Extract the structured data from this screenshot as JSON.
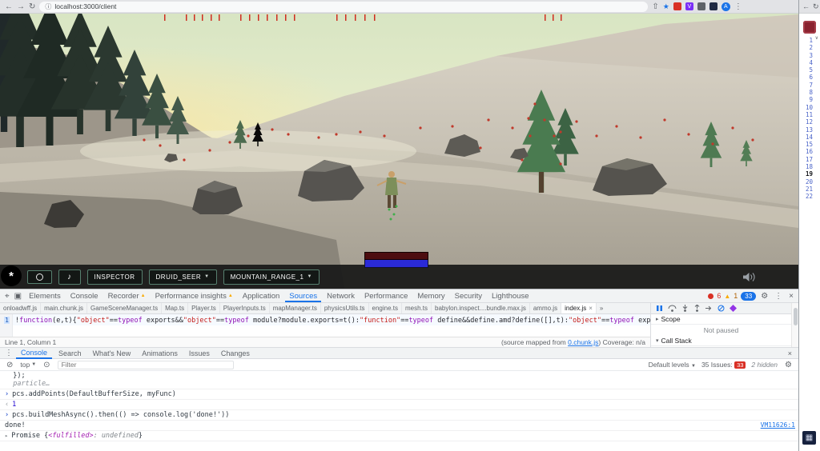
{
  "browser": {
    "url": "localhost:3000/client",
    "avatar": "A"
  },
  "game": {
    "hud": {
      "music_icon": "♪",
      "inspector_label": "INSPECTOR",
      "character_select": "DRUID_SEER",
      "map_select": "MOUNTAIN_RANGE_1"
    }
  },
  "devtools": {
    "tabs": [
      "Elements",
      "Console",
      "Recorder",
      "Performance insights",
      "Application",
      "Sources",
      "Network",
      "Performance",
      "Memory",
      "Security",
      "Lighthouse"
    ],
    "tab_badge": "▲",
    "error_count": "6",
    "warning_count": "1",
    "issues_count": "33",
    "source_tabs": [
      "onloadwff.js",
      "main.chunk.js",
      "GameSceneManager.ts",
      "Map.ts",
      "Player.ts",
      "PlayerInputs.ts",
      "mapManager.ts",
      "physicsUtils.ts",
      "engine.ts",
      "mesh.ts",
      "babylon.inspect....bundle.max.js",
      "ammo.js"
    ],
    "active_source_tab": "index.js",
    "overflow_chevron": "»",
    "code_line_number": "1",
    "code_segments": [
      {
        "t": "pl",
        "s": "!"
      },
      {
        "t": "kw",
        "s": "function"
      },
      {
        "t": "pl",
        "s": "(e,t){"
      },
      {
        "t": "str",
        "s": "\"object\""
      },
      {
        "t": "pl",
        "s": "=="
      },
      {
        "t": "kw",
        "s": "typeof"
      },
      {
        "t": "pl",
        "s": " exports&&"
      },
      {
        "t": "str",
        "s": "\"object\""
      },
      {
        "t": "pl",
        "s": "=="
      },
      {
        "t": "kw",
        "s": "typeof"
      },
      {
        "t": "pl",
        "s": " module?module.exports=t():"
      },
      {
        "t": "str",
        "s": "\"function\""
      },
      {
        "t": "pl",
        "s": "=="
      },
      {
        "t": "kw",
        "s": "typeof"
      },
      {
        "t": "pl",
        "s": " define&&define.amd?define([],t):"
      },
      {
        "t": "str",
        "s": "\"object\""
      },
      {
        "t": "pl",
        "s": "=="
      },
      {
        "t": "kw",
        "s": "typeof"
      },
      {
        "t": "pl",
        "s": " exports?exports.ReactErrorOverlay=t():e.ReactErrorOverlay=t()}(window,"
      }
    ],
    "status_left": "Line 1, Column 1",
    "mapped_prefix": "(source mapped from ",
    "mapped_link": "0.chunk.js",
    "mapped_suffix": ")  Coverage: n/a",
    "debugger_panel": {
      "scope_label": "Scope",
      "call_stack_label": "Call Stack",
      "not_paused": "Not paused"
    },
    "drawer_tabs": [
      "Console",
      "Search",
      "What's New",
      "Animations",
      "Issues",
      "Changes"
    ],
    "console_toolbar": {
      "context": "top",
      "filter_placeholder": "Filter",
      "levels": "Default levels",
      "issues_label": "35 Issues:",
      "issues_count": "33",
      "hidden_label": "2 hidden"
    },
    "console": {
      "pre1": "  });",
      "pre2": "  particle…",
      "cmd1": "pcs.addPoints(DefaultBufferSize, myFunc)",
      "res1": "1",
      "cmd2": "pcs.buildMeshAsync().then(() => console.log('done!'))",
      "log1": "done!",
      "log1_src": "VM11626:1",
      "res2_open": "Promise {",
      "res2_state": "<fulfilled>",
      "res2_value": ": undefined",
      "res2_close": "}"
    }
  },
  "right_window": {
    "line_numbers": [
      "1",
      "2",
      "3",
      "4",
      "5",
      "6",
      "7",
      "8",
      "9",
      "10",
      "11",
      "12",
      "13",
      "14",
      "15",
      "16",
      "17",
      "18",
      "19",
      "20",
      "21",
      "22"
    ]
  }
}
